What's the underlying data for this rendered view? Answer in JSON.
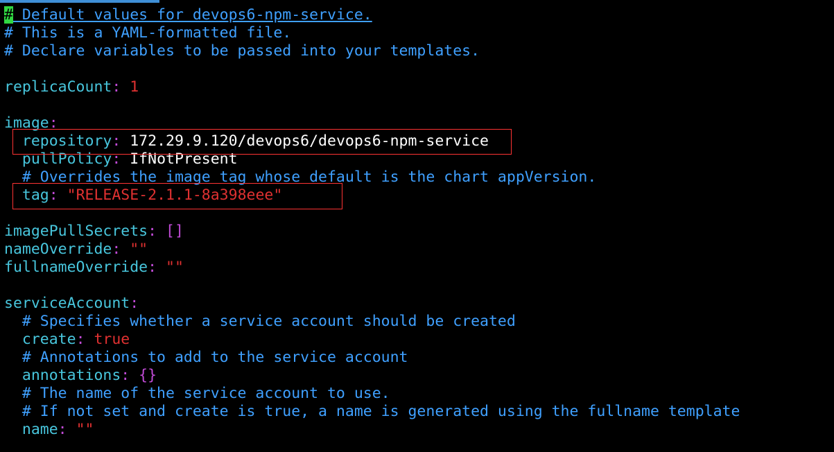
{
  "editor": {
    "colors": {
      "background": "#000000",
      "comment": "#3fa0ff",
      "key": "#48c6dd",
      "value_string": "#e03131",
      "value_number": "#e03131",
      "punctuation": "#c14bd6",
      "plain_text": "#ffffff",
      "cursor": "#31d842",
      "highlight_box": "#ff3333"
    },
    "cursor_char": "#",
    "lines": {
      "comment1_rest": " Default values for devops6-npm-service.",
      "comment2": "# This is a YAML-formatted file.",
      "comment3": "# Declare variables to be passed into your templates.",
      "replica_key": "replicaCount",
      "replica_value": "1",
      "image_key": "image",
      "repository_key": "repository",
      "repository_value": "172.29.9.120/devops6/devops6-npm-service",
      "pullpolicy_key": "pullPolicy",
      "pullpolicy_value": "IfNotPresent",
      "image_comment": "# Overrides the image tag whose default is the chart appVersion.",
      "tag_key": "tag",
      "tag_value": "\"RELEASE-2.1.1-8a398eee\"",
      "pullsecrets_key": "imagePullSecrets",
      "pullsecrets_value": "[]",
      "nameoverride_key": "nameOverride",
      "nameoverride_value": "\"\"",
      "fullnameoverride_key": "fullnameOverride",
      "fullnameoverride_value": "\"\"",
      "serviceaccount_key": "serviceAccount",
      "sa_comment1": "# Specifies whether a service account should be created",
      "create_key": "create",
      "create_value": "true",
      "sa_comment2": "# Annotations to add to the service account",
      "annotations_key": "annotations",
      "annotations_value": "{}",
      "sa_comment3": "# The name of the service account to use.",
      "sa_comment4": "# If not set and create is true, a name is generated using the fullname template",
      "name_key": "name",
      "name_value": "\"\""
    }
  }
}
